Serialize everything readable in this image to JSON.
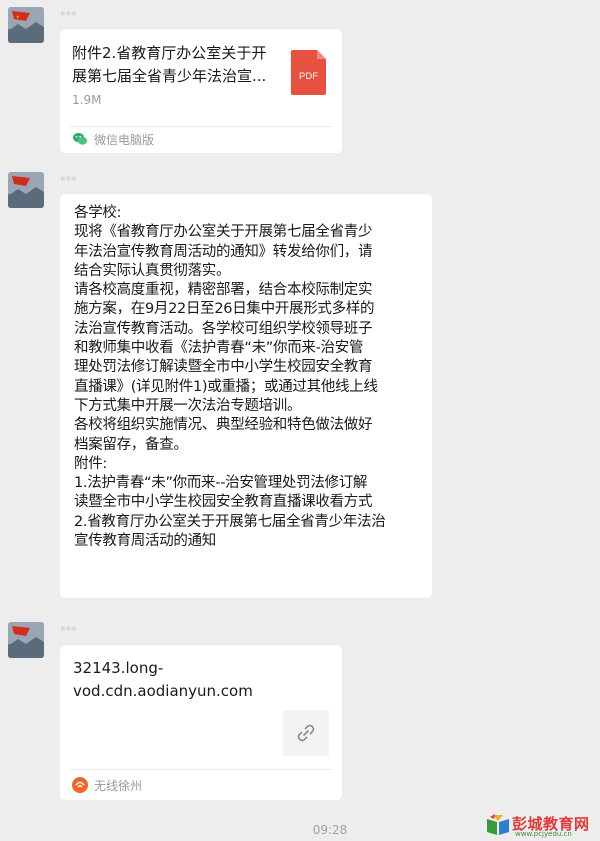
{
  "messages": [
    {
      "sender_name": "***",
      "file": {
        "title": "附件2.省教育厅办公室关于开\n展第七届全省青少年法治宣...",
        "size": "1.9M",
        "icon_label": "PDF",
        "source": "微信电脑版"
      }
    },
    {
      "sender_name": "***",
      "text_lines": [
        "各学校:",
        "现将《省教育厅办公室关于开展第七届全省青少",
        "年法治宣传教育周活动的通知》转发给你们，请",
        "结合实际认真贯彻落实。",
        "请各校高度重视，精密部署，结合本校际制定实",
        "施方案，在9月22日至26日集中开展形式多样的",
        "法治宣传教育活动。各学校可组织学校领导班子",
        "和教师集中收看《法护青春“未”你而来-治安管",
        "理处罚法修订解读暨全市中小学生校园安全教育",
        "直播课》(详见附件1)或重播；或通过其他线上线",
        "下方式集中开展一次法治专题培训。",
        "各校将组织实施情况、典型经验和特色做法做好",
        "档案留存，备查。",
        "附件:",
        "1.法护青春“未”你而来--治安管理处罚法修订解",
        "读暨全市中小学生校园安全教育直播课收看方式",
        "2.省教育厅办公室关于开展第七届全省青少年法治",
        "宣传教育周活动的通知"
      ]
    },
    {
      "sender_name": "***",
      "link": {
        "url": "32143.long-\nvod.cdn.aodianyun.com",
        "source": "无线徐州"
      }
    }
  ],
  "timestamp": "09:28",
  "watermark": {
    "name": "彭城教育网",
    "url": "www.pcjyedu.cn"
  },
  "colors": {
    "background": "#ededed",
    "bubble": "#ffffff",
    "pdf_red": "#e8503f",
    "wechat_green": "#2aae67",
    "xuzhou_orange": "#f26522"
  }
}
